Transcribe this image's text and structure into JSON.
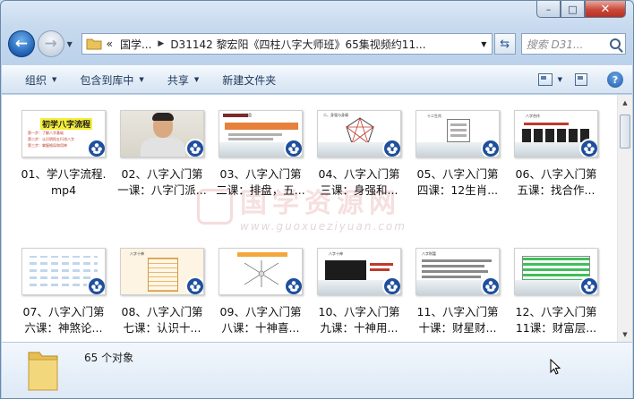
{
  "window": {
    "caption": {
      "minimize": "–",
      "maximize": "□",
      "close": "✕"
    }
  },
  "nav": {
    "back_icon": "back-arrow-icon",
    "forward_icon": "forward-arrow-icon",
    "breadcrumb": [
      "«",
      "国学...",
      "D31142 黎宏阳《四柱八字大师班》65集视频约11..."
    ],
    "search_placeholder": "搜索 D31..."
  },
  "commands": {
    "organize": "组织",
    "include_library": "包含到库中",
    "share": "共享",
    "new_folder": "新建文件夹"
  },
  "files": [
    {
      "name": "01、学八字流程.mp4",
      "line1": "01、学八字流程.",
      "line2": "mp4"
    },
    {
      "name": "02、八字入门第一课：八字门派...",
      "line1": "02、八字入门第",
      "line2": "一课：八字门派..."
    },
    {
      "name": "03、八字入门第二课：排盘，五...",
      "line1": "03、八字入门第",
      "line2": "二课：排盘，五..."
    },
    {
      "name": "04、八字入门第三课：身强和...",
      "line1": "04、八字入门第",
      "line2": "三课：身强和..."
    },
    {
      "name": "05、八字入门第四课：12生肖...",
      "line1": "05、八字入门第",
      "line2": "四课：12生肖..."
    },
    {
      "name": "06、八字入门第五课：找合作...",
      "line1": "06、八字入门第",
      "line2": "五课：找合作..."
    },
    {
      "name": "07、八字入门第六课：神煞论...",
      "line1": "07、八字入门第",
      "line2": "六课：神煞论..."
    },
    {
      "name": "08、八字入门第七课：认识十...",
      "line1": "08、八字入门第",
      "line2": "七课：认识十..."
    },
    {
      "name": "09、八字入门第八课：十神喜...",
      "line1": "09、八字入门第",
      "line2": "八课：十神喜..."
    },
    {
      "name": "10、八字入门第九课：十神用...",
      "line1": "10、八字入门第",
      "line2": "九课：十神用..."
    },
    {
      "name": "11、八字入门第十课：财星财...",
      "line1": "11、八字入门第",
      "line2": "十课：财星财..."
    },
    {
      "name": "12、八字入门第11课：财富层...",
      "line1": "12、八字入门第",
      "line2": "11课：财富层..."
    }
  ],
  "thumbs": {
    "t1": {
      "title": "初学八字流程",
      "l1": "第一步：了解八字基础",
      "l2": "第二步：认识阴阳五行排八字",
      "l3": "第三步：掌握格局和用神"
    },
    "t3": "一、八字排盘",
    "t4": "二、身强与身弱",
    "t5": "十二生肖",
    "t6": "八字合作",
    "t8": "八字十神",
    "t10": "八字十神",
    "t11": "八字财富"
  },
  "watermark": {
    "text": "国学资源网",
    "url": "www.guoxueziyuan.com"
  },
  "status": {
    "count": "65 个对象"
  },
  "colors": {
    "accent": "#1f4f9c",
    "command_text": "#1e395b",
    "close": "#c9483a"
  }
}
